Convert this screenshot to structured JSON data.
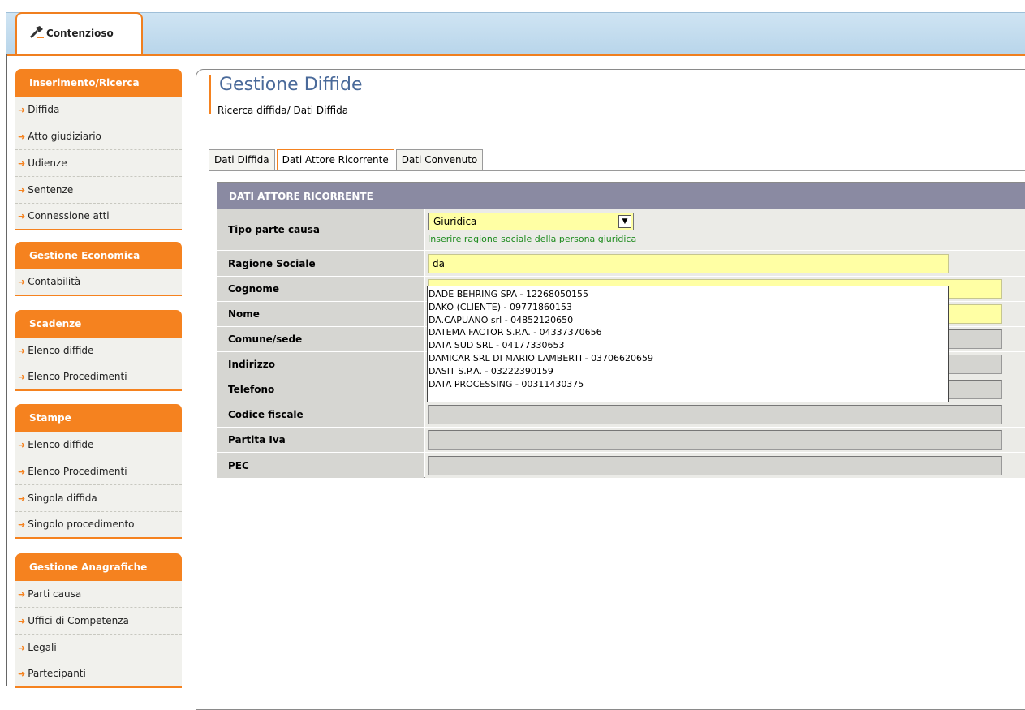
{
  "app_tab": {
    "label": "Contenzioso",
    "icon": "gavel-icon"
  },
  "sidebar": {
    "sections": [
      {
        "title": "Inserimento/Ricerca",
        "items": [
          "Diffida",
          "Atto giudiziario",
          "Udienze",
          "Sentenze",
          "Connessione atti"
        ]
      },
      {
        "title": "Gestione Economica",
        "items": [
          "Contabilità"
        ]
      },
      {
        "title": "Scadenze",
        "items": [
          "Elenco diffide",
          "Elenco Procedimenti"
        ]
      },
      {
        "title": "Stampe",
        "items": [
          "Elenco diffide",
          "Elenco Procedimenti",
          "Singola diffida",
          "Singolo procedimento"
        ]
      },
      {
        "title": "Gestione Anagrafiche",
        "items": [
          "Parti causa",
          "Uffici di Competenza",
          "Legali",
          "Partecipanti"
        ]
      }
    ]
  },
  "page": {
    "title": "Gestione Diffide",
    "breadcrumb": "Ricerca diffida/ Dati Diffida"
  },
  "tabs": [
    "Dati Diffida",
    "Dati Attore Ricorrente",
    "Dati Convenuto"
  ],
  "active_tab": "Dati Attore Ricorrente",
  "form": {
    "header": "DATI ATTORE RICORRENTE",
    "tipo_parte": {
      "label": "Tipo parte causa",
      "value": "Giuridica",
      "hint": "Inserire ragione sociale della persona giuridica"
    },
    "ragione_sociale": {
      "label": "Ragione Sociale",
      "value": "da"
    },
    "cognome": {
      "label": "Cognome",
      "value": ""
    },
    "nome": {
      "label": "Nome",
      "value": ""
    },
    "comune": {
      "label": "Comune/sede",
      "value": ""
    },
    "indirizzo": {
      "label": "Indirizzo",
      "value": ""
    },
    "telefono": {
      "label": "Telefono",
      "value": ""
    },
    "codice_fiscale": {
      "label": "Codice fiscale",
      "value": ""
    },
    "partita_iva": {
      "label": "Partita Iva",
      "value": ""
    },
    "pec": {
      "label": "PEC",
      "value": ""
    }
  },
  "autocomplete": [
    "DADE BEHRING SPA - 12268050155",
    "DAKO (CLIENTE) - 09771860153",
    "DA.CAPUANO srl - 04852120650",
    "DATEMA FACTOR S.P.A. - 04337370656",
    "DATA SUD SRL - 04177330653",
    "DAMICAR SRL DI MARIO LAMBERTI - 03706620659",
    "DASIT S.P.A. - 03222390159",
    "DATA PROCESSING - 00311430375"
  ],
  "colors": {
    "accent": "#f5821f",
    "title": "#4a6a9a",
    "header": "#8a8aa2",
    "input_yellow": "#ffffa4",
    "hint_green": "#1c8a1c"
  }
}
